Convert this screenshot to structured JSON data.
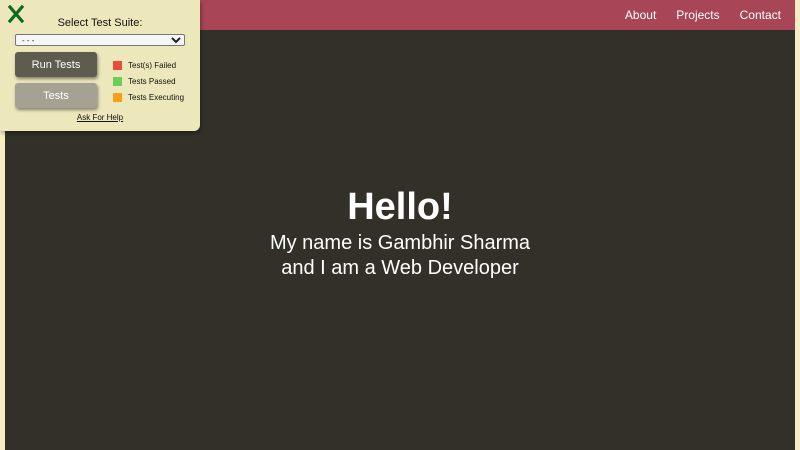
{
  "nav": {
    "links": [
      {
        "label": "About"
      },
      {
        "label": "Projects"
      },
      {
        "label": "Contact"
      }
    ]
  },
  "hero": {
    "title": "Hello!",
    "line1": "My name is Gambhir Sharma",
    "line2": "and I am a Web Developer"
  },
  "test_panel": {
    "close_icon": "close-x-icon",
    "heading": "Select Test Suite:",
    "select_value": "- - -",
    "run_button": "Run Tests",
    "tests_button": "Tests",
    "legend": [
      {
        "label": "Test(s) Failed",
        "color": "#e94b3c"
      },
      {
        "label": "Tests Passed",
        "color": "#6ad05a"
      },
      {
        "label": "Tests Executing",
        "color": "#f5a01a"
      }
    ],
    "help_link": "Ask For Help"
  },
  "colors": {
    "navbar": "#a84556",
    "stage_bg": "#33302a",
    "panel_bg": "#ede8bc",
    "page_border": "#f5eec4",
    "close_icon": "#0d6b1c"
  }
}
